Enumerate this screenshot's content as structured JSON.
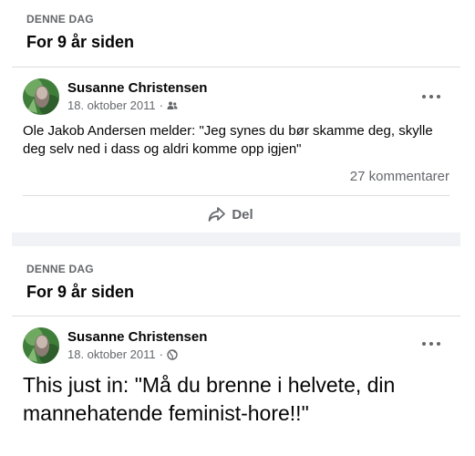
{
  "memories": [
    {
      "label": "DENNE DAG",
      "title": "For 9 år siden",
      "post": {
        "author": "Susanne Christensen",
        "date": "18. oktober 2011",
        "separator": "·",
        "audience_icon": "friends-icon",
        "text": "Ole Jakob Andersen melder: \"Jeg synes du bør skamme deg, skylle deg selv ned i dass og aldri komme opp igjen\"",
        "comments": "27 kommentarer",
        "share_label": "Del"
      }
    },
    {
      "label": "DENNE DAG",
      "title": "For 9 år siden",
      "post": {
        "author": "Susanne Christensen",
        "date": "18. oktober 2011",
        "separator": "·",
        "audience_icon": "globe-icon",
        "text": "This just in: \"Må du brenne i helvete, din mannehatende feminist-hore!!\""
      }
    }
  ],
  "colors": {
    "primary_text": "#050505",
    "secondary_text": "#65676b",
    "divider": "#dadde1",
    "band": "#f0f2f5"
  }
}
